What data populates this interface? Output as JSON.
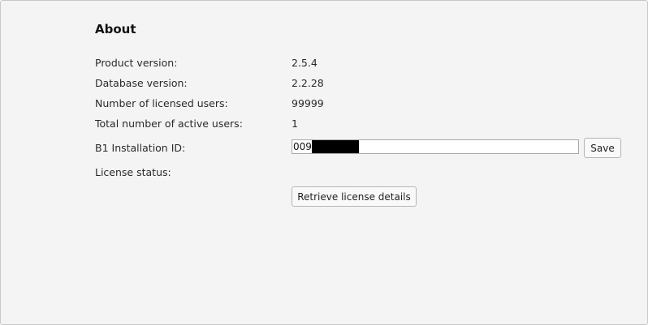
{
  "about": {
    "title": "About",
    "rows": [
      {
        "label": "Product version:",
        "value": "2.5.4"
      },
      {
        "label": "Database version:",
        "value": "2.2.28"
      },
      {
        "label": "Number of licensed users:",
        "value": "99999"
      },
      {
        "label": "Total number of active users:",
        "value": "1"
      }
    ],
    "installation_id": {
      "label": "B1 Installation ID:",
      "value": "009",
      "save_label": "Save"
    },
    "license_status": {
      "label": "License status:",
      "retrieve_label": "Retrieve license details"
    }
  },
  "colors": {
    "panel_background": "#f4f4f4",
    "redaction": "#000000"
  }
}
